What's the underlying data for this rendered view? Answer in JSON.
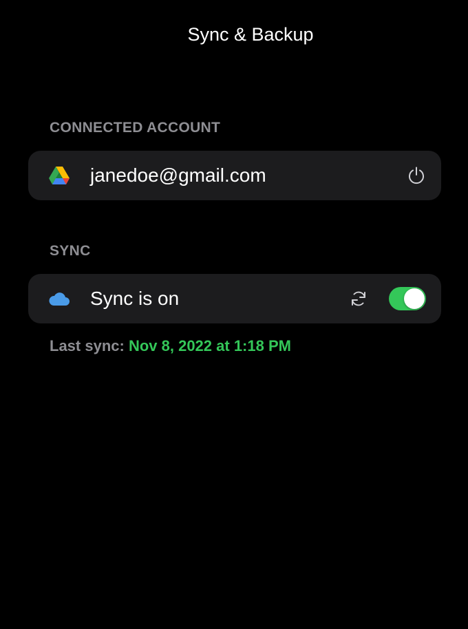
{
  "header": {
    "title": "Sync & Backup"
  },
  "account_section": {
    "label": "CONNECTED ACCOUNT",
    "provider_icon": "google-drive-icon",
    "email": "janedoe@gmail.com",
    "action_icon": "power-icon"
  },
  "sync_section": {
    "label": "SYNC",
    "cloud_icon": "cloud-icon",
    "status_text": "Sync is on",
    "refresh_icon": "refresh-icon",
    "toggle_on": true,
    "last_sync_label": "Last sync:",
    "last_sync_value": "Nov 8, 2022 at 1:18 PM"
  },
  "colors": {
    "background": "#000000",
    "card": "#1c1c1e",
    "section_label": "#8e8e93",
    "accent_green": "#34c759",
    "cloud_blue": "#4a9be8"
  }
}
